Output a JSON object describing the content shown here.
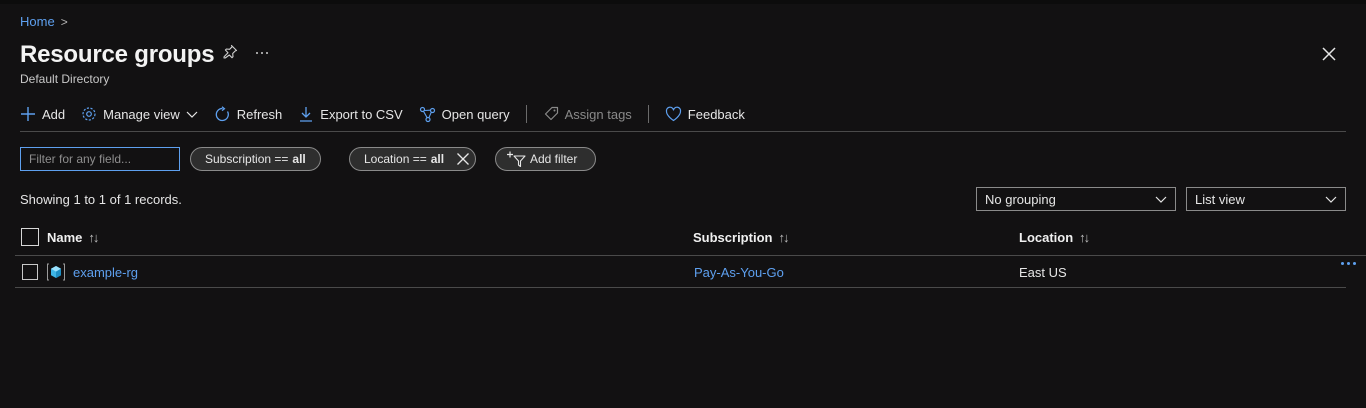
{
  "breadcrumb": {
    "home": "Home",
    "separator": ">"
  },
  "header": {
    "title": "Resource groups",
    "subtitle": "Default Directory",
    "pin_icon": "pin-icon",
    "more_icon": "ellipsis-icon",
    "close_icon": "close-icon"
  },
  "toolbar": {
    "add": "Add",
    "manage_view": "Manage view",
    "refresh": "Refresh",
    "export_csv": "Export to CSV",
    "open_query": "Open query",
    "assign_tags": "Assign tags",
    "feedback": "Feedback"
  },
  "filters": {
    "placeholder": "Filter for any field...",
    "subscription_label": "Subscription ==",
    "subscription_value": "all",
    "location_label": "Location ==",
    "location_value": "all",
    "add_filter": "Add filter"
  },
  "records_text": "Showing 1 to 1 of 1 records.",
  "grouping": {
    "selected": "No grouping"
  },
  "view": {
    "selected": "List view"
  },
  "table": {
    "columns": [
      "Name",
      "Subscription",
      "Location"
    ],
    "rows": [
      {
        "name": "example-rg",
        "subscription": "Pay-As-You-Go",
        "location": "East US"
      }
    ]
  },
  "colors": {
    "accent": "#5ea0ef",
    "background": "#121112",
    "border": "#4a4a4a"
  }
}
